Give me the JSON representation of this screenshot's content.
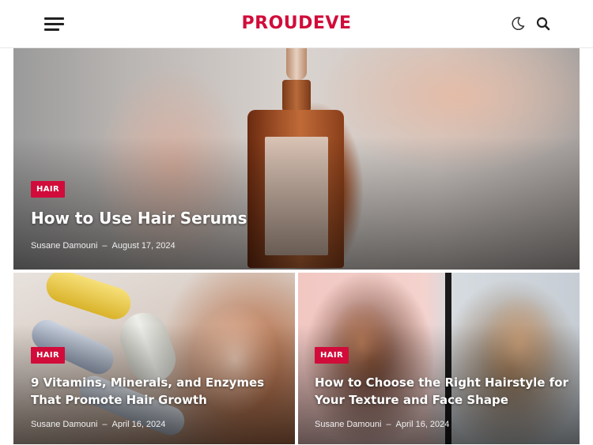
{
  "header": {
    "logo": "PROUDEVE",
    "menu_icon": "hamburger-menu-icon",
    "dark_mode_icon": "moon-icon",
    "search_icon": "search-icon"
  },
  "colors": {
    "accent": "#d10c3a",
    "text_dark": "#222222"
  },
  "posts": [
    {
      "category": "HAIR",
      "title": "How to Use Hair Serums",
      "author": "Susane Damouni",
      "separator": "–",
      "date": "August 17, 2024"
    },
    {
      "category": "HAIR",
      "title": "9 Vitamins, Minerals, and Enzymes That Promote Hair Growth",
      "author": "Susane Damouni",
      "separator": "–",
      "date": "April 16, 2024"
    },
    {
      "category": "HAIR",
      "title": "How to Choose the Right Hairstyle for Your Texture and Face Shape",
      "author": "Susane Damouni",
      "separator": "–",
      "date": "April 16, 2024"
    }
  ]
}
